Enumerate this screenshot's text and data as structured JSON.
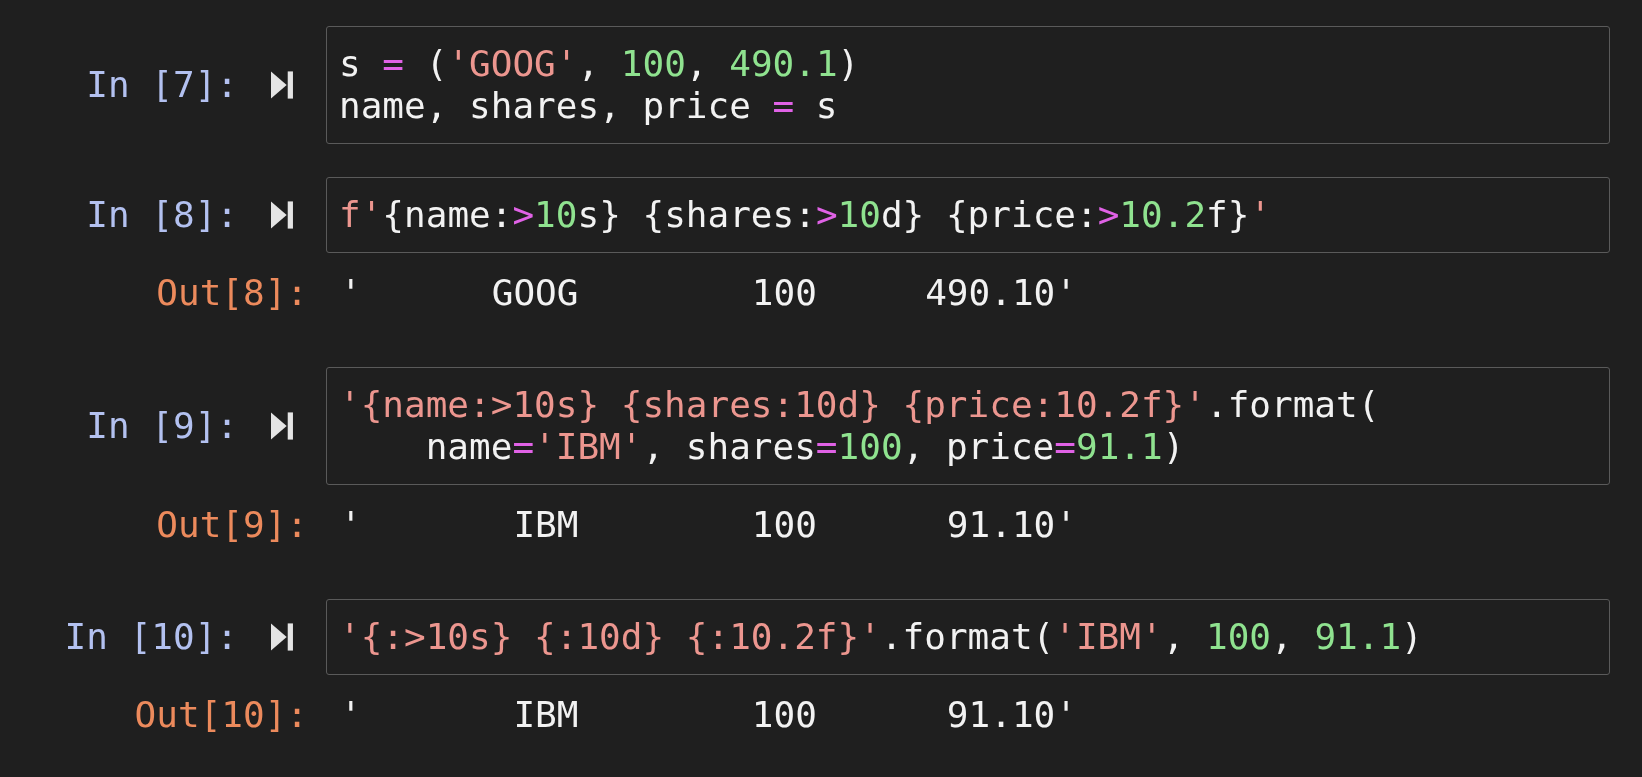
{
  "cells": [
    {
      "in_prompt": "In [7]:",
      "input": [
        [
          {
            "text": "s ",
            "kind": "plain"
          },
          {
            "text": "=",
            "kind": "operator"
          },
          {
            "text": " (",
            "kind": "plain"
          },
          {
            "text": "'GOOG'",
            "kind": "string"
          },
          {
            "text": ", ",
            "kind": "plain"
          },
          {
            "text": "100",
            "kind": "number"
          },
          {
            "text": ", ",
            "kind": "plain"
          },
          {
            "text": "490.1",
            "kind": "number"
          },
          {
            "text": ")",
            "kind": "plain"
          }
        ],
        [
          {
            "text": "name, shares, price ",
            "kind": "plain"
          },
          {
            "text": "=",
            "kind": "operator"
          },
          {
            "text": " s",
            "kind": "plain"
          }
        ]
      ]
    },
    {
      "in_prompt": "In [8]:",
      "input": [
        [
          {
            "text": "f'",
            "kind": "string"
          },
          {
            "text": "{name:",
            "kind": "plain"
          },
          {
            "text": ">",
            "kind": "operator"
          },
          {
            "text": "10",
            "kind": "number"
          },
          {
            "text": "s} {shares:",
            "kind": "plain"
          },
          {
            "text": ">",
            "kind": "operator"
          },
          {
            "text": "10",
            "kind": "number"
          },
          {
            "text": "d} {price:",
            "kind": "plain"
          },
          {
            "text": ">",
            "kind": "operator"
          },
          {
            "text": "10.2",
            "kind": "number"
          },
          {
            "text": "f}",
            "kind": "plain"
          },
          {
            "text": "'",
            "kind": "string"
          }
        ]
      ],
      "output": {
        "prompt": "Out[8]:",
        "text": "'      GOOG        100     490.10'"
      }
    },
    {
      "in_prompt": "In [9]:",
      "input": [
        [
          {
            "text": "'{name:>10s} {shares:10d} {price:10.2f}'",
            "kind": "string"
          },
          {
            "text": ".format(",
            "kind": "plain"
          }
        ],
        [
          {
            "text": "    name",
            "kind": "plain"
          },
          {
            "text": "=",
            "kind": "operator"
          },
          {
            "text": "'IBM'",
            "kind": "string"
          },
          {
            "text": ", shares",
            "kind": "plain"
          },
          {
            "text": "=",
            "kind": "operator"
          },
          {
            "text": "100",
            "kind": "number"
          },
          {
            "text": ", price",
            "kind": "plain"
          },
          {
            "text": "=",
            "kind": "operator"
          },
          {
            "text": "91.1",
            "kind": "number"
          },
          {
            "text": ")",
            "kind": "plain"
          }
        ]
      ],
      "output": {
        "prompt": "Out[9]:",
        "text": "'       IBM        100      91.10'"
      }
    },
    {
      "in_prompt": "In [10]:",
      "input": [
        [
          {
            "text": "'{:>10s} {:10d} {:10.2f}'",
            "kind": "string"
          },
          {
            "text": ".format(",
            "kind": "plain"
          },
          {
            "text": "'IBM'",
            "kind": "string"
          },
          {
            "text": ", ",
            "kind": "plain"
          },
          {
            "text": "100",
            "kind": "number"
          },
          {
            "text": ", ",
            "kind": "plain"
          },
          {
            "text": "91.1",
            "kind": "number"
          },
          {
            "text": ")",
            "kind": "plain"
          }
        ]
      ],
      "output": {
        "prompt": "Out[10]:",
        "text": "'       IBM        100      91.10'"
      }
    }
  ]
}
